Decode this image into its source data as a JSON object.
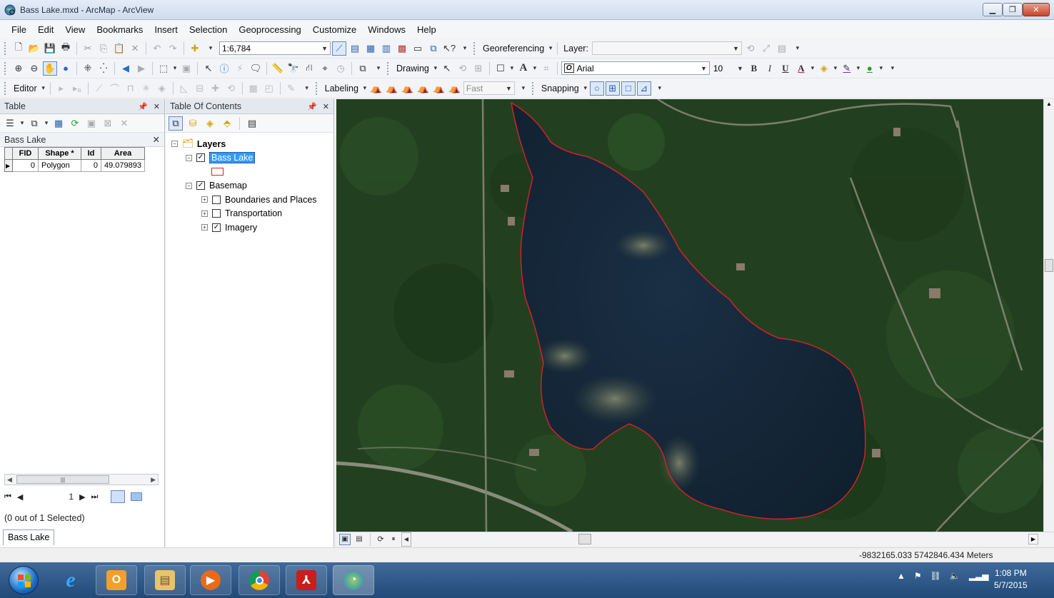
{
  "window": {
    "title": "Bass Lake.mxd - ArcMap - ArcView"
  },
  "menu": [
    "File",
    "Edit",
    "View",
    "Bookmarks",
    "Insert",
    "Selection",
    "Geoprocessing",
    "Customize",
    "Windows",
    "Help"
  ],
  "toolbar1": {
    "scale": "1:6,784",
    "georeferencing_label": "Georeferencing",
    "layer_label": "Layer:",
    "layer_value": ""
  },
  "toolbar2": {
    "drawing_label": "Drawing",
    "font_name": "Arial",
    "font_size": "10",
    "bold": "B",
    "italic": "I",
    "underline": "U",
    "text_tool": "A"
  },
  "toolbar3": {
    "editor_label": "Editor",
    "labeling_label": "Labeling",
    "quality": "Fast",
    "snapping_label": "Snapping"
  },
  "table_panel": {
    "title": "Table",
    "layer_name": "Bass Lake",
    "columns": [
      "FID",
      "Shape *",
      "Id",
      "Area"
    ],
    "rows": [
      {
        "fid": "0",
        "shape": "Polygon",
        "id": "0",
        "area": "49.079893"
      }
    ],
    "record_number": "1",
    "selection_status": "(0 out of 1 Selected)",
    "tab_label": "Bass Lake"
  },
  "toc": {
    "title": "Table Of Contents",
    "root": "Layers",
    "layers": [
      {
        "name": "Bass Lake",
        "checked": true,
        "selected": true
      },
      {
        "name": "Basemap",
        "checked": true,
        "selected": false
      }
    ],
    "basemap_children": [
      {
        "name": "Boundaries and Places",
        "checked": false
      },
      {
        "name": "Transportation",
        "checked": false
      },
      {
        "name": "Imagery",
        "checked": true
      }
    ]
  },
  "map": {
    "lake_outline_color": "#d0222a",
    "water_color": "#14283a",
    "forest_color": "#1f3a1c"
  },
  "status": {
    "coordinates": "-9832165.033  5742846.434 Meters"
  },
  "taskbar": {
    "time": "1:08 PM",
    "date": "5/7/2015",
    "apps": [
      "internet-explorer",
      "outlook",
      "file-explorer",
      "media-player",
      "chrome",
      "acrobat",
      "arcmap"
    ]
  }
}
